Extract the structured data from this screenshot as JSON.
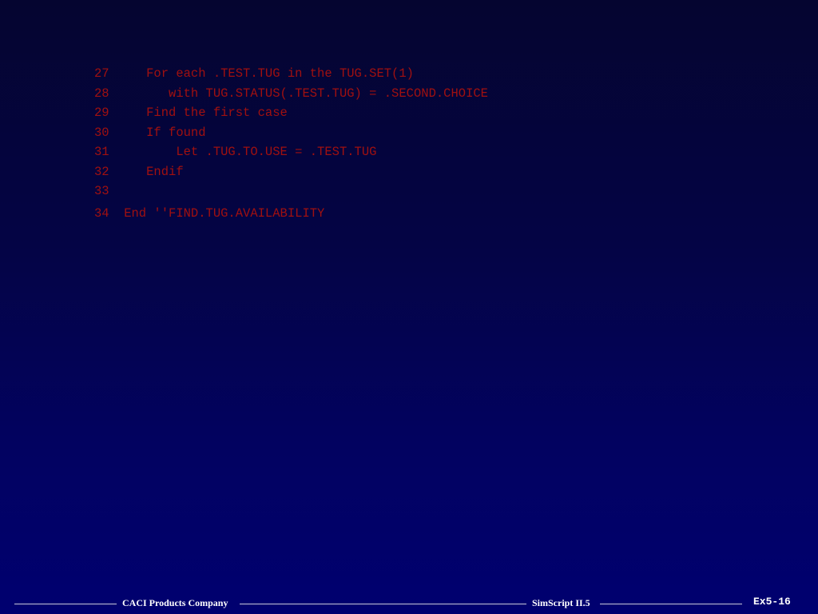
{
  "code": {
    "lines": [
      "27     For each .TEST.TUG in the TUG.SET(1)",
      "28        with TUG.STATUS(.TEST.TUG) = .SECOND.CHOICE",
      "29     Find the first case",
      "30     If found",
      "31         Let .TUG.TO.USE = .TEST.TUG",
      "32     Endif",
      "33",
      "34  End ''FIND.TUG.AVAILABILITY"
    ]
  },
  "footer": {
    "company": "CACI Products Company",
    "product": "SimScript II.5",
    "slide_number": "Ex5-16"
  },
  "colors": {
    "code_text": "#a01010",
    "footer_text": "#ffffff",
    "background_top": "#050530",
    "background_bottom": "#000070"
  }
}
